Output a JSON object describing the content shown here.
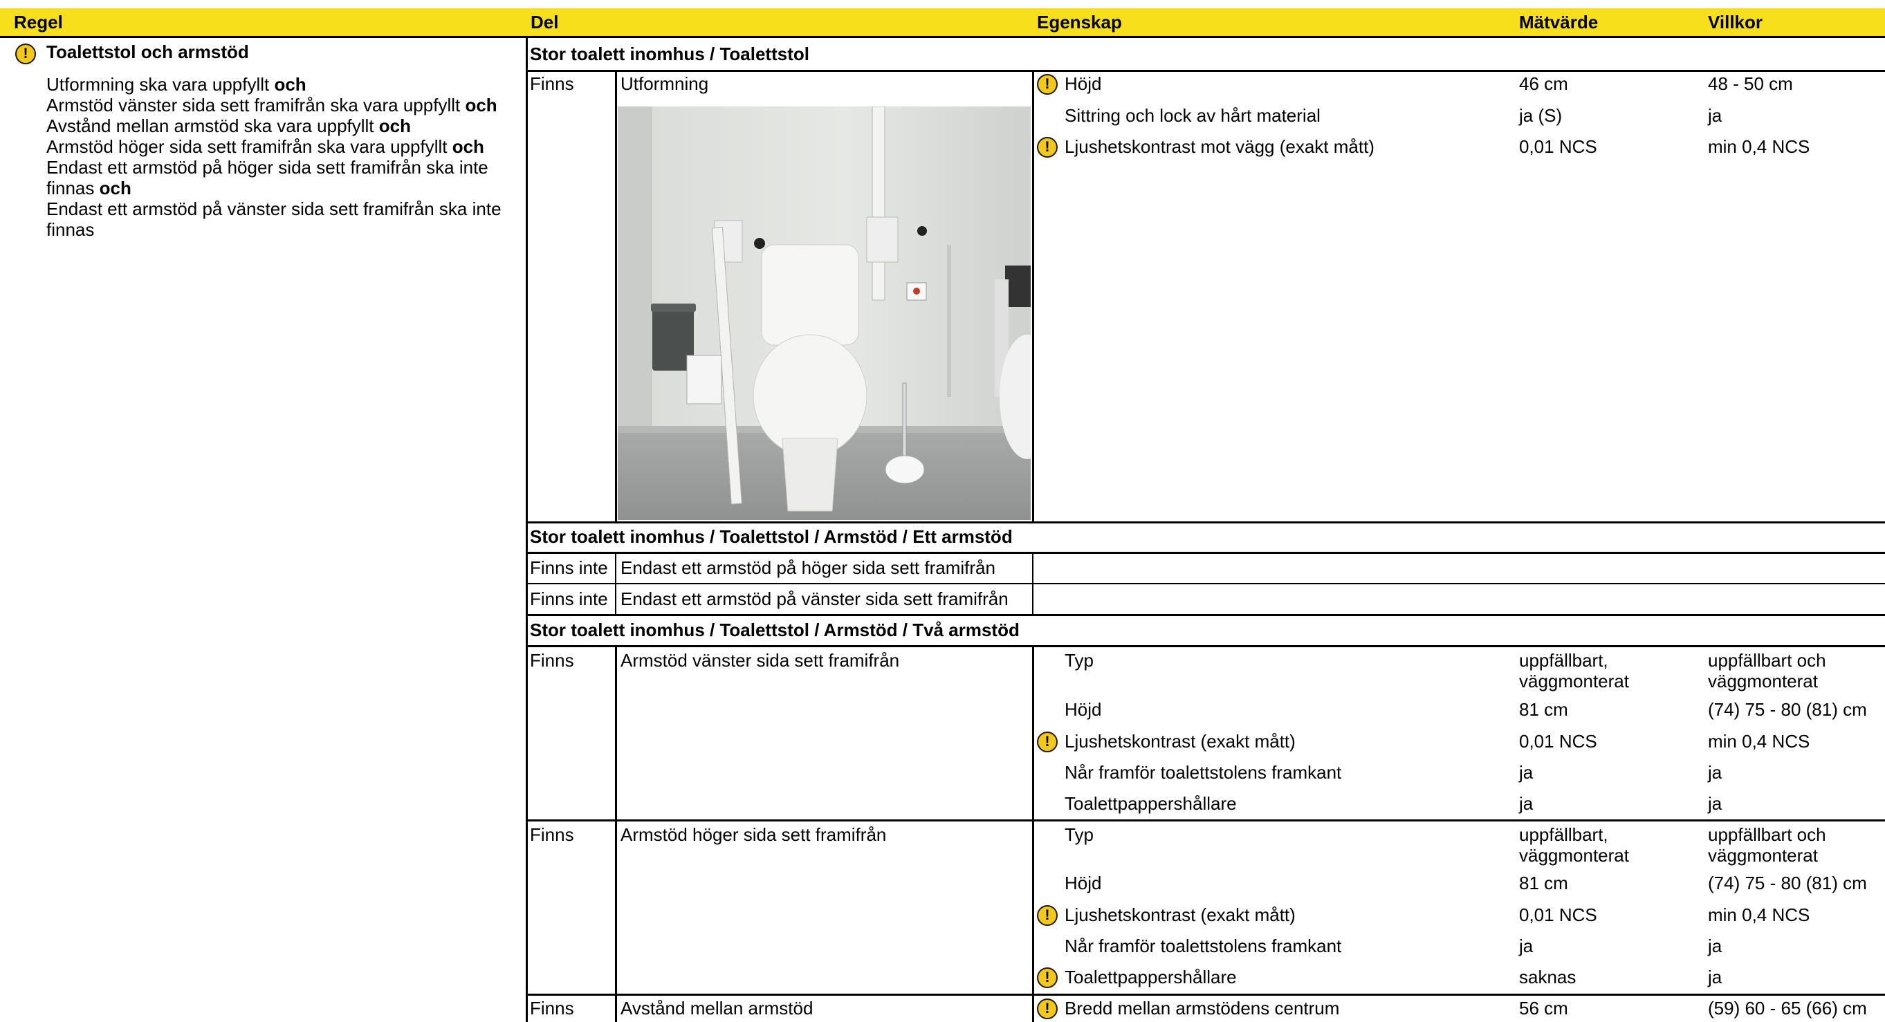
{
  "header": {
    "regel": "Regel",
    "del": "Del",
    "egenskap": "Egenskap",
    "matvarde": "Mätvärde",
    "villkor": "Villkor"
  },
  "rule": {
    "title": "Toalettstol och armstöd",
    "lines": [
      {
        "text": "Utformning ska vara uppfyllt ",
        "conj": "och"
      },
      {
        "text": "Armstöd vänster sida sett framifrån ska vara uppfyllt ",
        "conj": "och"
      },
      {
        "text": "Avstånd mellan armstöd ska vara uppfyllt ",
        "conj": "och"
      },
      {
        "text": "Armstöd höger sida sett framifrån ska vara uppfyllt ",
        "conj": "och"
      },
      {
        "text": "Endast ett armstöd på höger sida sett framifrån ska inte finnas ",
        "conj": "och"
      },
      {
        "text": "Endast ett armstöd på vänster sida sett framifrån ska inte finnas",
        "conj": ""
      }
    ]
  },
  "sections": [
    {
      "heading": "Stor toalett inomhus / Toalettstol",
      "rows": [
        {
          "status": "Finns",
          "part": "Utformning",
          "photo_caption": "Toalettstol med armstöd",
          "props": [
            {
              "warn": true,
              "name": "Höjd",
              "value": "46 cm",
              "cond": "48 - 50 cm"
            },
            {
              "warn": false,
              "name": "Sittring och lock av hårt material",
              "value": "ja (S)",
              "cond": "ja"
            },
            {
              "warn": true,
              "name": "Ljushetskontrast mot vägg (exakt mått)",
              "value": "0,01 NCS",
              "cond": "min 0,4 NCS"
            }
          ]
        }
      ]
    },
    {
      "heading": "Stor toalett inomhus / Toalettstol / Armstöd / Ett armstöd",
      "rows": [
        {
          "status": "Finns inte",
          "part": "Endast ett armstöd på höger sida sett framifrån"
        },
        {
          "status": "Finns inte",
          "part": "Endast ett armstöd på vänster sida sett framifrån"
        }
      ]
    },
    {
      "heading": "Stor toalett inomhus / Toalettstol / Armstöd / Två armstöd",
      "rows": [
        {
          "status": "Finns",
          "part": "Armstöd vänster sida sett framifrån",
          "props": [
            {
              "warn": false,
              "name": "Typ",
              "value": "uppfällbart,\nväggmonterat",
              "cond": "uppfällbart och\nväggmonterat"
            },
            {
              "warn": false,
              "name": "Höjd",
              "value": "81 cm",
              "cond": "(74) 75 - 80 (81) cm"
            },
            {
              "warn": true,
              "name": "Ljushetskontrast (exakt mått)",
              "value": "0,01 NCS",
              "cond": "min 0,4 NCS"
            },
            {
              "warn": false,
              "name": "Når framför toalettstolens framkant",
              "value": "ja",
              "cond": "ja"
            },
            {
              "warn": false,
              "name": "Toalettpappershållare",
              "value": "ja",
              "cond": "ja"
            }
          ]
        },
        {
          "status": "Finns",
          "part": "Armstöd höger sida sett framifrån",
          "props": [
            {
              "warn": false,
              "name": "Typ",
              "value": "uppfällbart,\nväggmonterat",
              "cond": "uppfällbart och\nväggmonterat"
            },
            {
              "warn": false,
              "name": "Höjd",
              "value": "81 cm",
              "cond": "(74) 75 - 80 (81) cm"
            },
            {
              "warn": true,
              "name": "Ljushetskontrast (exakt mått)",
              "value": "0,01 NCS",
              "cond": "min 0,4 NCS"
            },
            {
              "warn": false,
              "name": "Når framför toalettstolens framkant",
              "value": "ja",
              "cond": "ja"
            },
            {
              "warn": true,
              "name": "Toalettpappershållare",
              "value": "saknas",
              "cond": "ja"
            }
          ]
        },
        {
          "status": "Finns",
          "part": "Avstånd mellan armstöd",
          "props": [
            {
              "warn": true,
              "name": "Bredd mellan armstödens centrum",
              "value": "56 cm",
              "cond": "(59) 60 - 65 (66) cm"
            }
          ]
        }
      ]
    }
  ],
  "icons": {
    "warning": "warning-icon",
    "warning_glyph": "!"
  },
  "colors": {
    "header_bg": "#f7e01b",
    "warning_fill": "#f4c81a"
  }
}
